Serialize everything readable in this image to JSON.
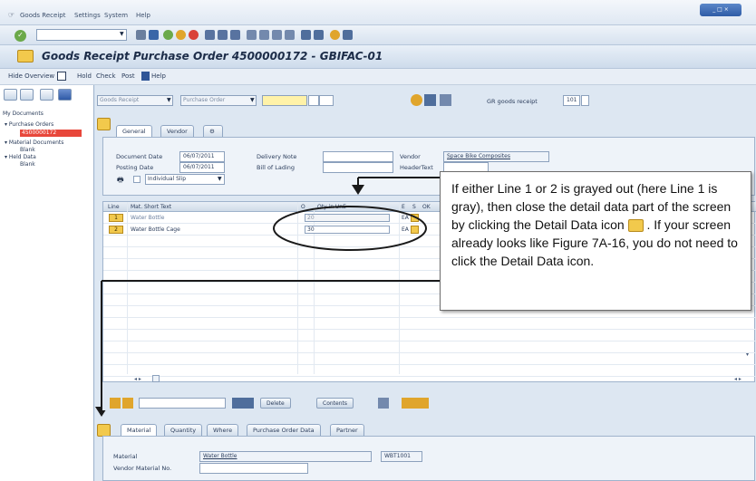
{
  "menu": [
    "Goods Receipt",
    "Settings",
    "System",
    "Help"
  ],
  "title": "Goods Receipt Purchase Order 4500000172 - GBIFAC-01",
  "app_toolbar": {
    "hide_overview": "Hide Overview",
    "hold": "Hold",
    "check": "Check",
    "post": "Post",
    "help": "Help"
  },
  "tree": {
    "root": "My Documents",
    "purchase_orders": "Purchase Orders",
    "po_number": "4500000172",
    "material_documents": "Material Documents",
    "blank1": "Blank",
    "held_data": "Held Data",
    "blank2": "Blank"
  },
  "header": {
    "transaction": "Goods Receipt",
    "reference": "Purchase Order",
    "po_value": "",
    "gr_label": "GR goods receipt",
    "gr_code": "101"
  },
  "tabs": [
    "General",
    "Vendor"
  ],
  "general": {
    "doc_date_label": "Document Date",
    "doc_date": "06/07/2011",
    "post_date_label": "Posting Date",
    "post_date": "06/07/2011",
    "slip": "Individual Slip",
    "delivery_note_label": "Delivery Note",
    "bill_of_lading_label": "Bill of Lading",
    "vendor_label": "Vendor",
    "vendor_value": "Space Bike Composites",
    "header_text_label": "HeaderText"
  },
  "items": {
    "columns": [
      "Line",
      "Mat. Short Text",
      "O",
      "Qty in UnE",
      "E",
      "S",
      "OK"
    ],
    "rows": [
      {
        "line": "1",
        "text": "Water Bottle",
        "qty": "20",
        "unit": "EA"
      },
      {
        "line": "2",
        "text": "Water Bottle Cage",
        "qty": "30",
        "unit": "EA"
      }
    ]
  },
  "callout": {
    "text_before_icon": "If either Line 1 or 2 is grayed out (here Line 1 is gray), then close the detail data part of the screen by clicking the Detail Data icon",
    "text_after_icon": ". If your screen already looks like Figure 7A-16, you do not need to click the Detail Data icon."
  },
  "detail_toolbar": {
    "delete": "Delete",
    "contents": "Contents"
  },
  "detail_tabs": [
    "Material",
    "Quantity",
    "Where",
    "Purchase Order Data",
    "Partner"
  ],
  "detail": {
    "material_label": "Material",
    "material_value": "Water Bottle",
    "material_code": "WBT1001",
    "vendor_mat_label": "Vendor Material No."
  },
  "colors": {
    "selection": "#e8473b",
    "highlight_yellow": "#f2c94c",
    "background": "#dde7f2"
  }
}
